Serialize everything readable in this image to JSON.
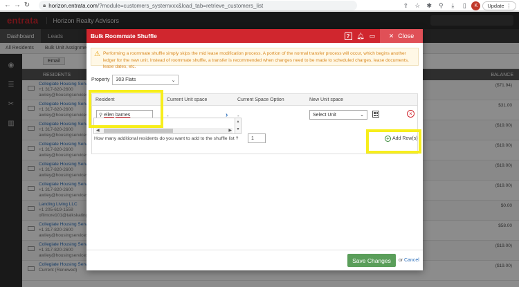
{
  "browser": {
    "url_host": "horizon.entrata.com",
    "url_path": "/?module=customers_systemxxx&load_tab=retrieve_customers_list",
    "profile_initial": "K",
    "update_label": "Update"
  },
  "app": {
    "logo": "entrata",
    "company": "Horizon Realty Advisors",
    "nav_tabs": [
      "Dashboard",
      "Leads"
    ],
    "sub_nav": [
      "All Residents",
      "Bulk Unit Assignment"
    ],
    "toolbar_email": "Email",
    "table_header_left": "RESIDENTS",
    "table_header_right": "BALANCE"
  },
  "bg_rows": [
    {
      "name": "Collegiate Housing Servi",
      "phone": "+1 317-820-2600",
      "email": "awiley@housingservices",
      "balance": "($71.94)"
    },
    {
      "name": "Collegiate Housing Servi",
      "phone": "+1 317-820-2600",
      "email": "awiley@housingservices",
      "balance": "$31.00"
    },
    {
      "name": "Collegiate Housing Servi",
      "phone": "+1 317-820-2600",
      "email": "awiley@housingservices",
      "balance": "($19.00)"
    },
    {
      "name": "Collegiate Housing Servi",
      "phone": "+1 317-820-2600",
      "email": "awiley@housingservices",
      "balance": "($19.00)"
    },
    {
      "name": "Collegiate Housing Servi",
      "phone": "+1 317-820-2600",
      "email": "awiley@housingservices",
      "balance": "($19.00)"
    },
    {
      "name": "Collegiate Housing Servi",
      "phone": "+1 317-820-2600",
      "email": "awiley@housingservices",
      "balance": "($19.00)"
    },
    {
      "name": "Landing Living LLC",
      "phone": "+1 205-619-1558",
      "email": "ofilmore101@talkskating",
      "balance": "$0.00"
    },
    {
      "name": "Collegiate Housing Servi",
      "phone": "+1 317-820-2600",
      "email": "awiley@housingservices",
      "balance": "$58.00"
    },
    {
      "name": "Collegiate Housing Servi",
      "phone": "+1 317-820-2600",
      "email": "awiley@housingservices",
      "balance": "($19.00)"
    },
    {
      "name": "Collegiate Housing Services",
      "phone": "",
      "email": "Current (Renewed)",
      "balance": "($19.00)"
    }
  ],
  "modal": {
    "title": "Bulk Roommate Shuffle",
    "close_label": "Close",
    "warning": "Performing a roommate shuffle simply skips the mid lease modification process. A portion of the normal transfer process will occur, which begins another ledger for the new unit. Instead of roommate shuffle, a transfer is recommended when changes need to be made to scheduled charges, lease documents, lease dates, etc.",
    "property_label": "Property",
    "property_value": "303 Flats",
    "columns": [
      "Resident",
      "Current Unit space",
      "Current Space Option",
      "New Unit space"
    ],
    "resident_search_first": "ellen",
    "resident_search_second": "barnes",
    "current_unit": "-",
    "current_option": "-",
    "new_unit_placeholder": "Select Unit",
    "how_many_text": "How many additional residents do you want to add to the shuffle list ?",
    "how_many_value": "1",
    "add_rows_label": "Add Row(s)",
    "save_label": "Save Changes",
    "or_label": "or",
    "cancel_label": "Cancel"
  },
  "colors": {
    "brand_red": "#d0262e",
    "highlight": "#f7ee1c",
    "save_green": "#5a9e5a",
    "warning_text": "#d9881f"
  },
  "icons": [
    "back-arrow-icon",
    "forward-arrow-icon",
    "reload-icon",
    "lock-icon",
    "help-icon",
    "bell-icon",
    "chat-icon",
    "close-icon",
    "warning-icon",
    "search-icon",
    "chevron-right-icon",
    "dropdown-caret-icon",
    "calendar-grid-icon",
    "remove-circle-icon",
    "add-circle-icon"
  ]
}
